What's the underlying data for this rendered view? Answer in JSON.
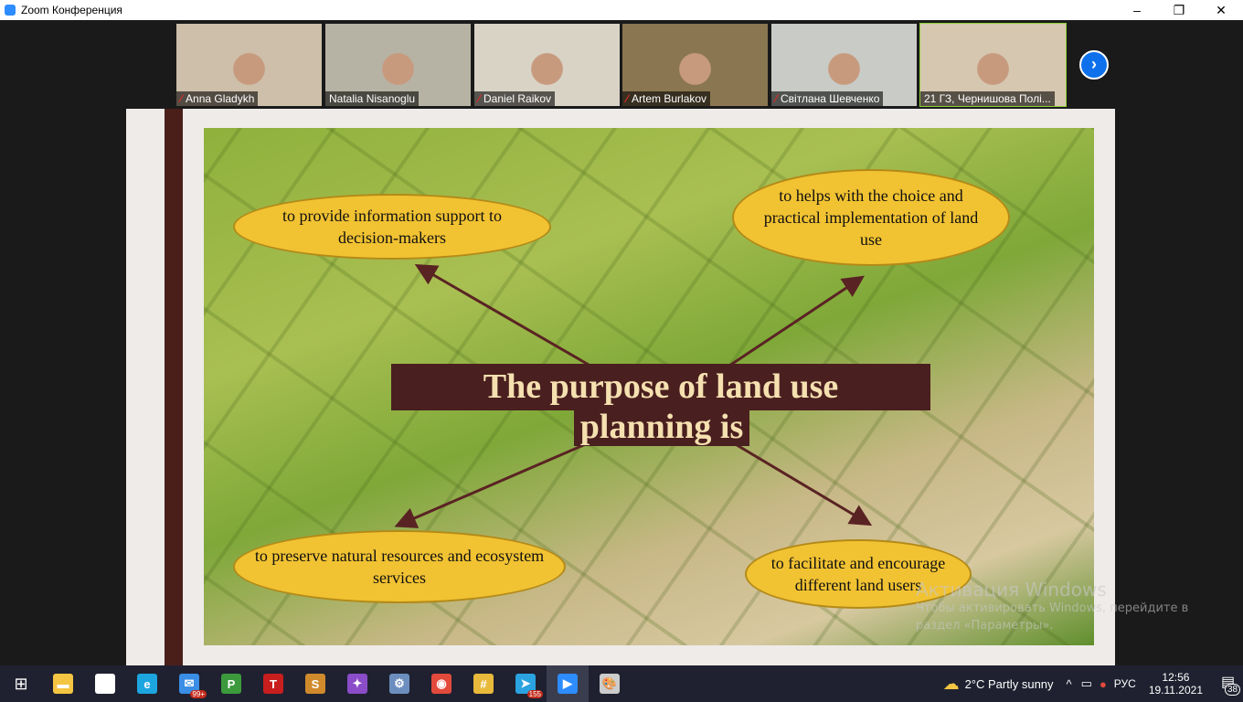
{
  "window": {
    "title": "Zoom Конференция",
    "minimize": "–",
    "restore": "❐",
    "close": "✕"
  },
  "participants": [
    {
      "name": "Anna Gladykh",
      "muted": true,
      "bg": "#cdbfa9"
    },
    {
      "name": "Natalia Nisanoglu",
      "muted": false,
      "bg": "#b7b3a4"
    },
    {
      "name": "Daniel Raikov",
      "muted": true,
      "bg": "#d9d3c6"
    },
    {
      "name": "Artem Burlakov",
      "muted": true,
      "bg": "#8a7650"
    },
    {
      "name": "Світлана Шевченко",
      "muted": true,
      "bg": "#c9ccc6"
    },
    {
      "name": "21 ГЗ, Чернишова Полі...",
      "muted": false,
      "bg": "#d6c7b0",
      "active": true
    }
  ],
  "next_page": "›",
  "slide": {
    "title_line1": "The purpose of land use",
    "title_line2": "planning is",
    "items": [
      "to provide information support to decision-makers",
      "to helps with the choice and practical implementation of land use",
      "to preserve natural resources and ecosystem services",
      "to facilitate and encourage different land users"
    ]
  },
  "watermark": {
    "line1": "Активация Windows",
    "line2": "Чтобы активировать Windows, перейдите в",
    "line3": "раздел «Параметры»."
  },
  "taskbar": {
    "apps": [
      {
        "name": "file-explorer",
        "glyph": "▬",
        "color": "#f4c542"
      },
      {
        "name": "store",
        "glyph": "▣",
        "color": "#fff"
      },
      {
        "name": "edge",
        "glyph": "e",
        "color": "#1da5e0"
      },
      {
        "name": "mail",
        "glyph": "✉",
        "color": "#3a8ee6",
        "badge": "99+"
      },
      {
        "name": "project-p",
        "glyph": "P",
        "color": "#3c9a3c"
      },
      {
        "name": "app-t",
        "glyph": "T",
        "color": "#c81e1e"
      },
      {
        "name": "app-s",
        "glyph": "S",
        "color": "#d08a2c"
      },
      {
        "name": "app-folder",
        "glyph": "✦",
        "color": "#8a4cc8"
      },
      {
        "name": "control-panel",
        "glyph": "⚙",
        "color": "#6c8ebf"
      },
      {
        "name": "chrome",
        "glyph": "◉",
        "color": "#e24a3b"
      },
      {
        "name": "slack",
        "glyph": "#",
        "color": "#e8b93a"
      },
      {
        "name": "telegram",
        "glyph": "➤",
        "color": "#2aa3e0",
        "badge": "155"
      },
      {
        "name": "zoom",
        "glyph": "▶",
        "color": "#2d8cff",
        "active": true
      },
      {
        "name": "paint",
        "glyph": "🎨",
        "color": "#ccc"
      }
    ],
    "weather": "2°C  Partly sunny",
    "lang": "РУС",
    "time": "12:56",
    "date": "19.11.2021",
    "notifications": "38"
  }
}
